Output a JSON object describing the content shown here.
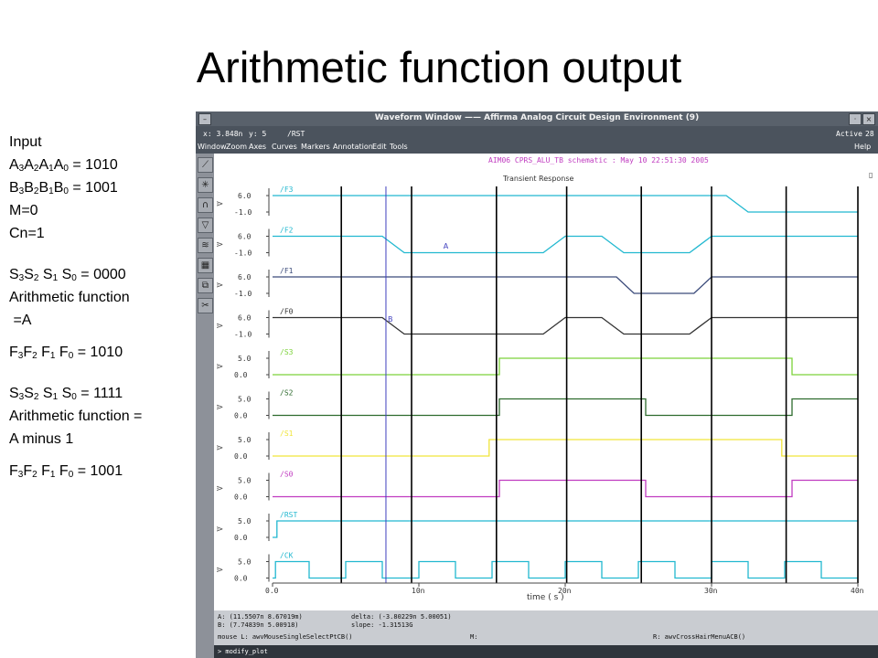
{
  "slide": {
    "title": "Arithmetic function output"
  },
  "notes": {
    "input_label": "Input",
    "a_eq": "= 1010",
    "b_eq": "= 1001",
    "m": "M=0",
    "cn": "Cn=1",
    "s_eq_1": "= 0000",
    "func_label_1": "Arithmetic function",
    "func_value_1": " =A",
    "f_eq_1": "= 1010",
    "s_eq_2": "= 1111",
    "func_label_2": "Arithmetic function =",
    "func_value_2": "A minus 1",
    "f_eq_2": "= 1001"
  },
  "window": {
    "title": "Waveform Window —— Affirma Analog Circuit Design Environment (9)",
    "close_glyph": "×",
    "status": {
      "x": "x: 3.848n",
      "y": "y: 5",
      "signal": "/RST",
      "state": "Active",
      "count": "28"
    },
    "menu": [
      "Window",
      "Zoom",
      "Axes",
      "Curves",
      "Markers",
      "Annotation",
      "Edit",
      "Tools"
    ],
    "help": "Help",
    "tool_icons": [
      "zoom-line-icon",
      "crosshair-icon",
      "magnet-icon",
      "delta-icon",
      "strip-icon",
      "grid-icon",
      "copy-icon",
      "cut-icon"
    ],
    "plot_header": "AIM06 CPRS_ALU_TB schematic : May 10 22:51:30 2005",
    "plot_subtitle": "Transient Response",
    "marker_a": "A",
    "marker_b": "B",
    "x_axis_label": "time ( s )",
    "info_a": "A: (11.5507n 8.67019m)",
    "info_b": "B: (7.74839n 5.00918)",
    "info_delta": "delta: (-3.80229n 5.00051)",
    "info_slope": "slope: -1.31513G",
    "mouse_l": "mouse L: awvMouseSingleSelectPtCB()",
    "mouse_m": "M:",
    "mouse_r": "R: awvCrossHairMenuACB()",
    "command": "> modify_plot",
    "colors": {
      "window_bg": "#8d9199",
      "plot_bg": "#ffffff",
      "cyan": "#22b8d0",
      "navy": "#3a4a7a",
      "dark": "#333333",
      "green_light": "#7cd23a",
      "green_dark": "#2e6b2e",
      "yellow": "#f0e53a",
      "magenta": "#c03cc0",
      "cursor_blue": "#3f3fbe"
    }
  },
  "chart_data": {
    "type": "line",
    "xlabel": "time ( s )",
    "xlim": [
      0,
      40
    ],
    "x_ticks": [
      "0.0",
      "10n",
      "20n",
      "30n",
      "40n"
    ],
    "time_unit": "ns",
    "cursor_a_x": 11.5507,
    "cursor_b_x": 7.74839,
    "edge_lines_x": [
      4.7,
      9.5,
      15.3,
      20.1,
      25.2,
      30.0,
      35.1,
      40.0
    ],
    "series": [
      {
        "name": "/F3",
        "ytick_hi": "6.0",
        "ytick_lo": "-1.0",
        "color_key": "cyan",
        "points": [
          [
            0,
            1
          ],
          [
            31,
            1
          ],
          [
            32.5,
            0
          ],
          [
            40,
            0
          ]
        ]
      },
      {
        "name": "/F2",
        "ytick_hi": "6.0",
        "ytick_lo": "-1.0",
        "color_key": "cyan",
        "points": [
          [
            0,
            1
          ],
          [
            7.5,
            1
          ],
          [
            9,
            0
          ],
          [
            18.5,
            0
          ],
          [
            20,
            1
          ],
          [
            22.5,
            1
          ],
          [
            24,
            0
          ],
          [
            28.5,
            0
          ],
          [
            30,
            1
          ],
          [
            40,
            1
          ]
        ]
      },
      {
        "name": "/F1",
        "ytick_hi": "6.0",
        "ytick_lo": "-1.0",
        "color_key": "navy",
        "points": [
          [
            0,
            1
          ],
          [
            23.5,
            1
          ],
          [
            24.7,
            0
          ],
          [
            28.8,
            0
          ],
          [
            30,
            1
          ],
          [
            40,
            1
          ]
        ]
      },
      {
        "name": "/F0",
        "ytick_hi": "6.0",
        "ytick_lo": "-1.0",
        "color_key": "dark",
        "points": [
          [
            0,
            1
          ],
          [
            7.5,
            1
          ],
          [
            9,
            0
          ],
          [
            18.5,
            0
          ],
          [
            20,
            1
          ],
          [
            22.5,
            1
          ],
          [
            24,
            0
          ],
          [
            28.5,
            0
          ],
          [
            30,
            1
          ],
          [
            40,
            1
          ]
        ]
      },
      {
        "name": "/S3",
        "ytick_hi": "5.0",
        "ytick_lo": "0.0",
        "color_key": "green_light",
        "points": [
          [
            0,
            0
          ],
          [
            15.5,
            0
          ],
          [
            15.5,
            1
          ],
          [
            35.5,
            1
          ],
          [
            35.5,
            0
          ],
          [
            40,
            0
          ]
        ]
      },
      {
        "name": "/S2",
        "ytick_hi": "5.0",
        "ytick_lo": "0.0",
        "color_key": "green_dark",
        "points": [
          [
            0,
            0
          ],
          [
            15.5,
            0
          ],
          [
            15.5,
            1
          ],
          [
            25.5,
            1
          ],
          [
            25.5,
            0
          ],
          [
            35.5,
            0
          ],
          [
            35.5,
            1
          ],
          [
            40,
            1
          ]
        ]
      },
      {
        "name": "/S1",
        "ytick_hi": "5.0",
        "ytick_lo": "0.0",
        "color_key": "yellow",
        "points": [
          [
            0,
            0
          ],
          [
            14.8,
            0
          ],
          [
            14.8,
            1
          ],
          [
            34.8,
            1
          ],
          [
            34.8,
            0
          ],
          [
            40,
            0
          ]
        ]
      },
      {
        "name": "/S0",
        "ytick_hi": "5.0",
        "ytick_lo": "0.0",
        "color_key": "magenta",
        "points": [
          [
            0,
            0
          ],
          [
            15.5,
            0
          ],
          [
            15.5,
            1
          ],
          [
            25.5,
            1
          ],
          [
            25.5,
            0
          ],
          [
            35.5,
            0
          ],
          [
            35.5,
            1
          ],
          [
            40,
            1
          ]
        ]
      },
      {
        "name": "/RST",
        "ytick_hi": "5.0",
        "ytick_lo": "0.0",
        "color_key": "cyan",
        "points": [
          [
            0,
            0
          ],
          [
            0.3,
            0
          ],
          [
            0.3,
            1
          ],
          [
            40,
            1
          ]
        ]
      },
      {
        "name": "/CK",
        "ytick_hi": "5.0",
        "ytick_lo": "0.0",
        "color_key": "cyan",
        "points": [
          [
            0,
            0
          ],
          [
            0.2,
            0
          ],
          [
            0.2,
            1
          ],
          [
            2.5,
            1
          ],
          [
            2.5,
            0
          ],
          [
            5,
            0
          ],
          [
            5,
            1
          ],
          [
            7.5,
            1
          ],
          [
            7.5,
            0
          ],
          [
            10,
            0
          ],
          [
            10,
            1
          ],
          [
            12.5,
            1
          ],
          [
            12.5,
            0
          ],
          [
            15,
            0
          ],
          [
            15,
            1
          ],
          [
            17.5,
            1
          ],
          [
            17.5,
            0
          ],
          [
            20,
            0
          ],
          [
            20,
            1
          ],
          [
            22.5,
            1
          ],
          [
            22.5,
            0
          ],
          [
            25,
            0
          ],
          [
            25,
            1
          ],
          [
            27.5,
            1
          ],
          [
            27.5,
            0
          ],
          [
            30,
            0
          ],
          [
            30,
            1
          ],
          [
            32.5,
            1
          ],
          [
            32.5,
            0
          ],
          [
            35,
            0
          ],
          [
            35,
            1
          ],
          [
            37.5,
            1
          ],
          [
            37.5,
            0
          ],
          [
            40,
            0
          ]
        ]
      }
    ]
  }
}
